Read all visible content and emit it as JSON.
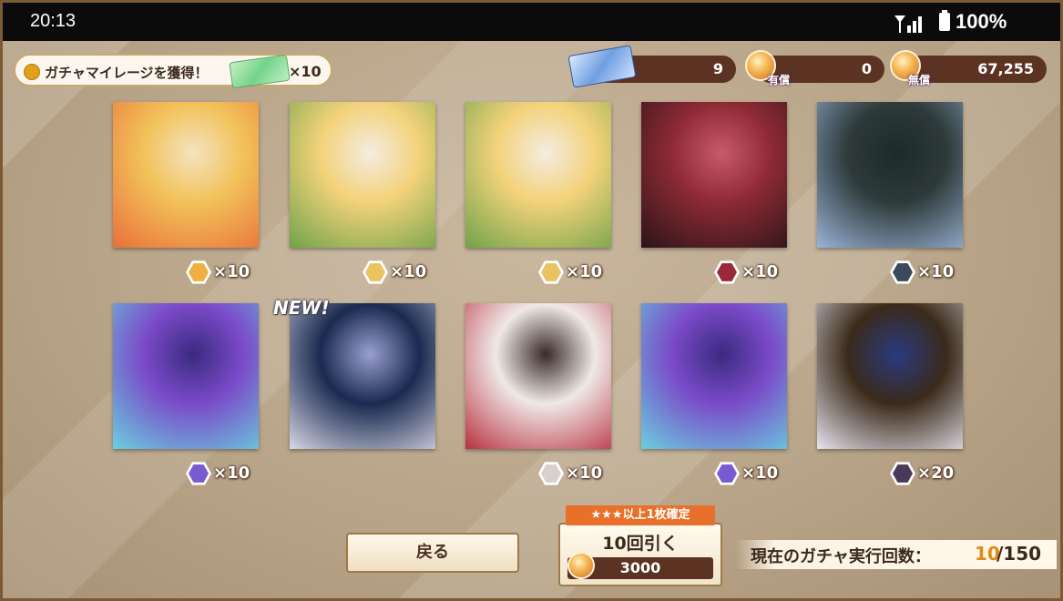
{
  "status_bar": {
    "time": "20:13",
    "battery": "100%"
  },
  "mileage_banner": {
    "text": "ガチャマイレージを獲得！",
    "multiplier": "×10"
  },
  "currencies": {
    "tickets": "9",
    "paid_label": "有償",
    "paid": "0",
    "free_label": "無償",
    "free": "67,255"
  },
  "results": [
    {
      "multiplier": "×10",
      "colors": [
        "#f2c25a",
        "#e9703a",
        "#f5e3c0"
      ],
      "accent": "#f0b040",
      "new": false
    },
    {
      "multiplier": "×10",
      "colors": [
        "#f3d27a",
        "#6fa34a",
        "#f4ece0"
      ],
      "accent": "#e8c360",
      "new": false
    },
    {
      "multiplier": "×10",
      "colors": [
        "#f3d27a",
        "#6fa34a",
        "#f4ece0"
      ],
      "accent": "#e8c360",
      "new": false
    },
    {
      "multiplier": "×10",
      "colors": [
        "#8e2a35",
        "#2a1418",
        "#c85a6a"
      ],
      "accent": "#9a2a3a",
      "new": false
    },
    {
      "multiplier": "×10",
      "colors": [
        "#2e3a3a",
        "#9ab4d8",
        "#1d2a2a"
      ],
      "accent": "#3a4a5a",
      "new": false
    },
    {
      "multiplier": "×10",
      "colors": [
        "#7a4ac8",
        "#6ad0e0",
        "#3a2a80"
      ],
      "accent": "#7a5ad0",
      "new": false
    },
    {
      "multiplier": "",
      "colors": [
        "#1a2a50",
        "#d8d8e6",
        "#9aa0d0"
      ],
      "accent": "#a0a0c0",
      "new": true
    },
    {
      "multiplier": "×10",
      "colors": [
        "#efe9e6",
        "#b83040",
        "#3a2a2a"
      ],
      "accent": "#d8d0d0",
      "new": false
    },
    {
      "multiplier": "×10",
      "colors": [
        "#7a4ac8",
        "#6ad0e0",
        "#3a2a80"
      ],
      "accent": "#7a5ad0",
      "new": false
    },
    {
      "multiplier": "×20",
      "colors": [
        "#3a2a1a",
        "#e8e6f0",
        "#2a3a80"
      ],
      "accent": "#4a3a5a",
      "new": false
    }
  ],
  "new_label": "NEW!",
  "buttons": {
    "back": "戻る",
    "guarantee": "★★★以上1枚確定",
    "pull10": "10回引く",
    "pull10_cost": "3000"
  },
  "gacha_count": {
    "label": "現在のガチャ実行回数：",
    "current": "10",
    "total": "/150"
  }
}
